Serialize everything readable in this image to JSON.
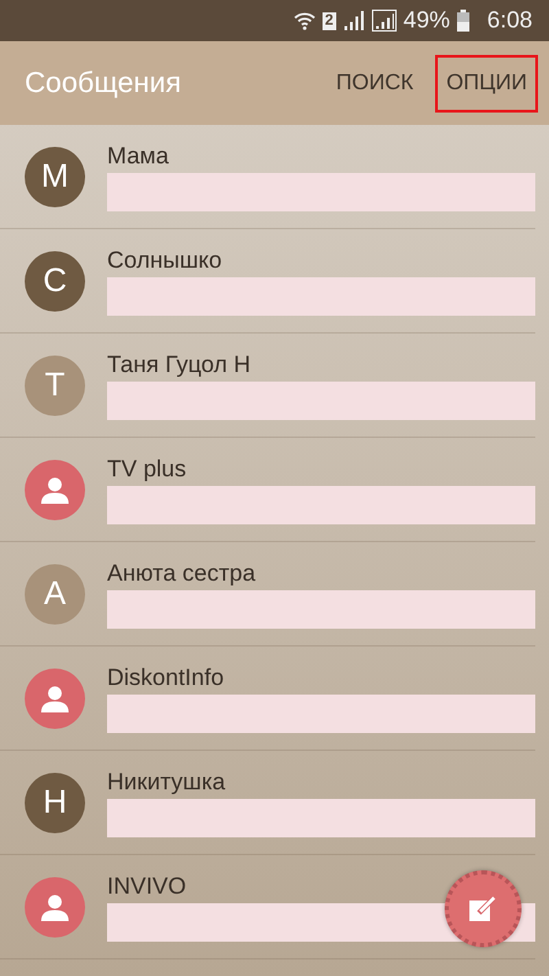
{
  "status_bar": {
    "sim": "2",
    "battery_text": "49%",
    "time": "6:08"
  },
  "header": {
    "title": "Сообщения",
    "actions": [
      {
        "label": "ПОИСК",
        "highlighted": false
      },
      {
        "label": "ОПЦИИ",
        "highlighted": true
      }
    ]
  },
  "conversations": [
    {
      "name": "Мама",
      "avatar": {
        "kind": "letter",
        "letter": "М",
        "color": "#6f5a42"
      }
    },
    {
      "name": "Солнышко",
      "avatar": {
        "kind": "letter",
        "letter": "С",
        "color": "#6f5a42"
      }
    },
    {
      "name": "Таня Гуцол Н",
      "avatar": {
        "kind": "letter",
        "letter": "Т",
        "color": "#a8927a"
      }
    },
    {
      "name": "TV plus",
      "avatar": {
        "kind": "person",
        "color": "#d9666b"
      }
    },
    {
      "name": "Анюта сестра",
      "avatar": {
        "kind": "letter",
        "letter": "А",
        "color": "#a8927a"
      }
    },
    {
      "name": "DiskontInfo",
      "avatar": {
        "kind": "person",
        "color": "#d9666b"
      }
    },
    {
      "name": "Никитушка",
      "avatar": {
        "kind": "letter",
        "letter": "Н",
        "color": "#6f5a42"
      }
    },
    {
      "name": "INVIVO",
      "avatar": {
        "kind": "person",
        "color": "#d9666b"
      }
    }
  ]
}
